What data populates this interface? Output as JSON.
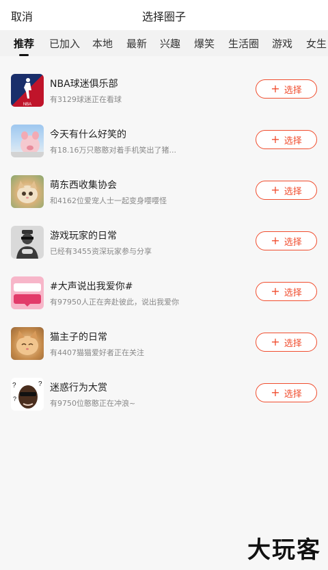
{
  "header": {
    "cancel": "取消",
    "title": "选择圈子"
  },
  "tabs": [
    {
      "label": "推荐",
      "active": true
    },
    {
      "label": "已加入"
    },
    {
      "label": "本地"
    },
    {
      "label": "最新"
    },
    {
      "label": "兴趣"
    },
    {
      "label": "爆笑"
    },
    {
      "label": "生活圈"
    },
    {
      "label": "游戏"
    },
    {
      "label": "女生"
    }
  ],
  "groups": [
    {
      "name": "NBA球迷俱乐部",
      "desc": "有3129球迷正在看球",
      "avatar": "nba-logo-icon"
    },
    {
      "name": "今天有什么好笑的",
      "desc": "有18.16万只憨憨对着手机笑出了猪...",
      "avatar": "pig-cosplay-icon"
    },
    {
      "name": "萌东西收集协会",
      "desc": "和4162位爱宠人士一起变身嘤嘤怪",
      "avatar": "kitten-icon"
    },
    {
      "name": "游戏玩家的日常",
      "desc": "已经有3455资深玩家参与分享",
      "avatar": "gamer-icon"
    },
    {
      "name": "#大声说出我爱你#",
      "desc": "有97950人正在奔赴彼此，说出我爱你",
      "avatar": "love-sticker-icon"
    },
    {
      "name": "猫主子的日常",
      "desc": "有4407猫猫爱好者正在关注",
      "avatar": "cat-icon"
    },
    {
      "name": "迷惑行为大赏",
      "desc": "有9750位憨憨正在冲浪~",
      "avatar": "confused-face-icon"
    }
  ],
  "join_label": "选择",
  "watermark": "大玩客",
  "colors": {
    "accent": "#f04c2d",
    "tabs_bg": "#f2f2f2",
    "page_bg": "#f7f7f7"
  }
}
